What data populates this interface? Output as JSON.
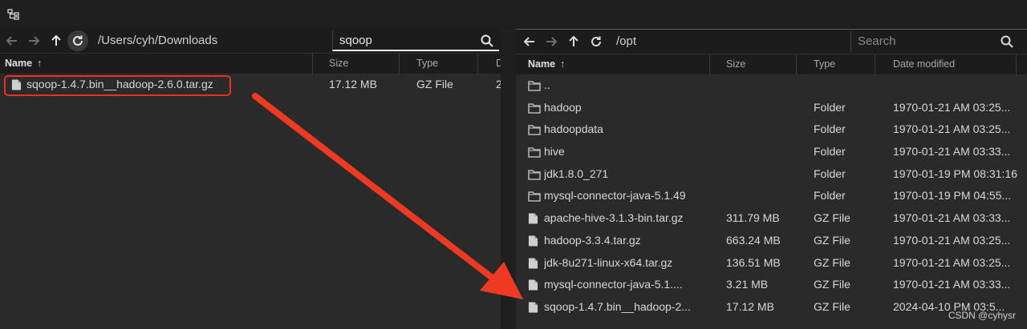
{
  "left": {
    "path": "/Users/cyh/Downloads",
    "search_value": "sqoop",
    "columns": {
      "name": "Name",
      "size": "Size",
      "type": "Type",
      "date": "D"
    },
    "sort_indicator": "↑",
    "rows": [
      {
        "name": "sqoop-1.4.7.bin__hadoop-2.6.0.tar.gz",
        "size": "17.12 MB",
        "type": "GZ File",
        "date": "2"
      }
    ]
  },
  "right": {
    "path": "/opt",
    "search_placeholder": "Search",
    "columns": {
      "name": "Name",
      "size": "Size",
      "type": "Type",
      "date": "Date modified"
    },
    "sort_indicator": "↑",
    "rows": [
      {
        "kind": "folder",
        "name": "..",
        "size": "",
        "type": "",
        "date": ""
      },
      {
        "kind": "folder",
        "name": "hadoop",
        "size": "",
        "type": "Folder",
        "date": "1970-01-21 AM 03:25..."
      },
      {
        "kind": "folder",
        "name": "hadoopdata",
        "size": "",
        "type": "Folder",
        "date": "1970-01-21 AM 03:25..."
      },
      {
        "kind": "folder",
        "name": "hive",
        "size": "",
        "type": "Folder",
        "date": "1970-01-21 AM 03:33..."
      },
      {
        "kind": "folder",
        "name": "jdk1.8.0_271",
        "size": "",
        "type": "Folder",
        "date": "1970-01-19 PM 08:31:16"
      },
      {
        "kind": "folder",
        "name": "mysql-connector-java-5.1.49",
        "size": "",
        "type": "Folder",
        "date": "1970-01-19 PM 04:55..."
      },
      {
        "kind": "file",
        "name": "apache-hive-3.1.3-bin.tar.gz",
        "size": "311.79 MB",
        "type": "GZ File",
        "date": "1970-01-21 AM 03:33..."
      },
      {
        "kind": "file",
        "name": "hadoop-3.3.4.tar.gz",
        "size": "663.24 MB",
        "type": "GZ File",
        "date": "1970-01-21 AM 03:25..."
      },
      {
        "kind": "file",
        "name": "jdk-8u271-linux-x64.tar.gz",
        "size": "136.51 MB",
        "type": "GZ File",
        "date": "1970-01-21 AM 03:25..."
      },
      {
        "kind": "file",
        "name": "mysql-connector-java-5.1....",
        "size": "3.21 MB",
        "type": "GZ File",
        "date": "1970-01-21 AM 03:33..."
      },
      {
        "kind": "file",
        "name": "sqoop-1.4.7.bin__hadoop-2...",
        "size": "17.12 MB",
        "type": "GZ File",
        "date": "2024-04-10 PM 03:5..."
      }
    ]
  },
  "watermark": "CSDN @cyhysr",
  "colors": {
    "highlight": "#e8321e",
    "arrow": "#ee3a22"
  },
  "icons": {
    "back": "arrow-left-icon",
    "forward": "arrow-right-icon",
    "up": "arrow-up-icon",
    "refresh": "refresh-icon",
    "search": "search-icon",
    "folder": "folder-icon",
    "file": "file-icon",
    "tree": "tree-view-icon"
  }
}
